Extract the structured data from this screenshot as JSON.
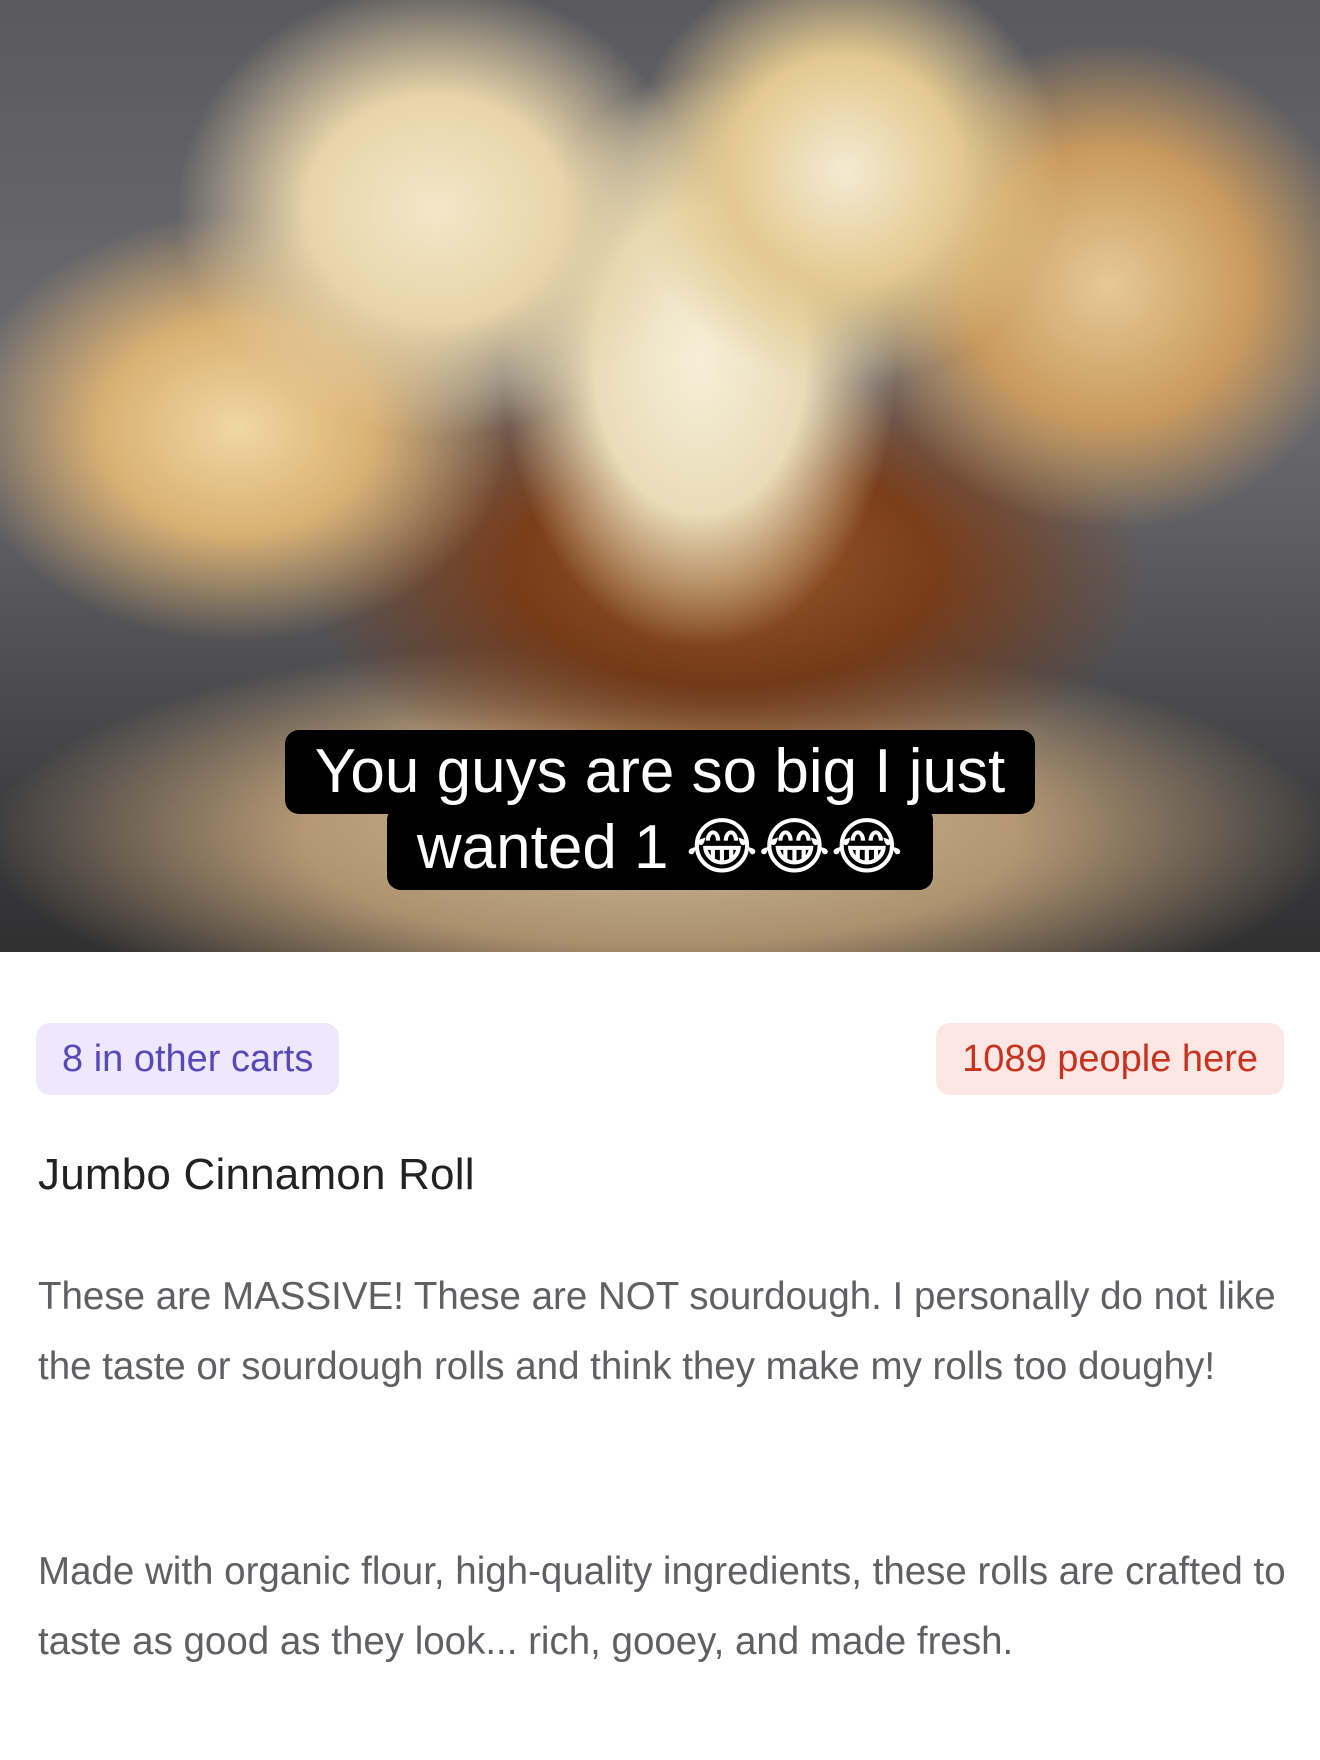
{
  "hero": {
    "image_alt": "Close-up of a torn-open jumbo cinnamon roll with dripping icing",
    "caption_line1": "You guys are so big I just",
    "caption_line2": "wanted 1 😂😂😂"
  },
  "badges": {
    "carts": "8 in other carts",
    "people": "1089 people here",
    "carts_color": "#5b48b8",
    "carts_bg": "#ede8fb",
    "people_color": "#c8331f",
    "people_bg": "#fde7e4"
  },
  "product": {
    "title": "Jumbo Cinnamon Roll",
    "description_1": "These are MASSIVE! These are NOT sourdough. I personally do not like the taste or sourdough rolls and think they make my rolls too doughy!",
    "description_2": "Made with organic flour, high-quality ingredients, these rolls are crafted to taste as good as they look... rich, gooey, and made fresh."
  }
}
